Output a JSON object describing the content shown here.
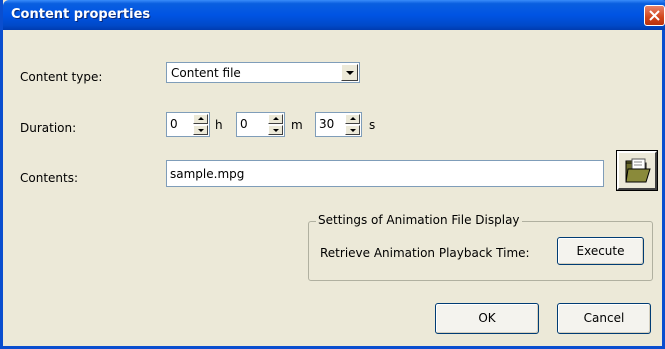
{
  "window": {
    "title": "Content properties"
  },
  "fields": {
    "content_type_label": "Content type:",
    "content_type_value": "Content file",
    "duration_label": "Duration:",
    "duration": {
      "hours": "0",
      "hours_unit": "h",
      "minutes": "0",
      "minutes_unit": "m",
      "seconds": "30",
      "seconds_unit": "s"
    },
    "contents_label": "Contents:",
    "contents_value": "sample.mpg"
  },
  "animation_group": {
    "title": "Settings of Animation File Display",
    "retrieve_label": "Retrieve Animation Playback Time:",
    "execute_button": "Execute"
  },
  "footer": {
    "ok_button": "OK",
    "cancel_button": "Cancel"
  },
  "icons": {
    "close": "close-icon",
    "browse": "folder-open-icon",
    "dropdown": "chevron-down-icon"
  },
  "colors": {
    "titlebar": "#0054e3",
    "close_button": "#d1451b",
    "dialog_background": "#ece9d8"
  }
}
